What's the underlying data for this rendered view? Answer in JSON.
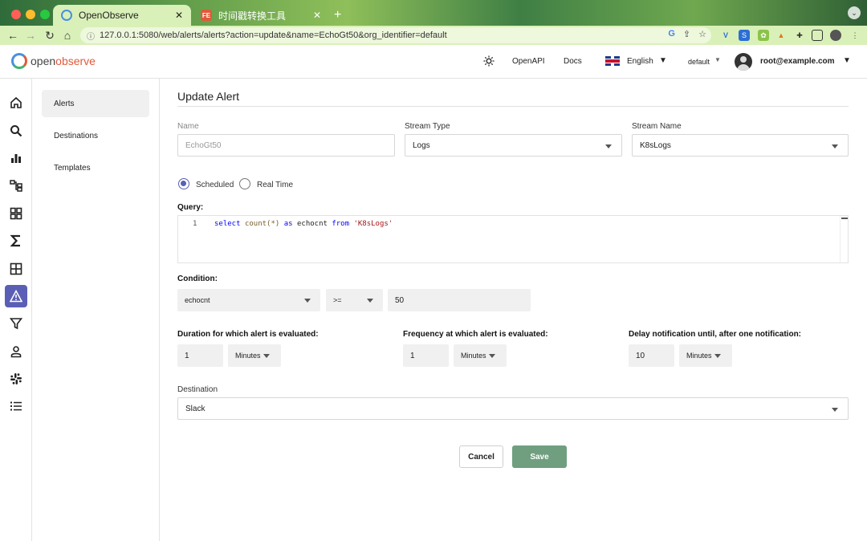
{
  "browser": {
    "tabs": [
      {
        "title": "OpenObserve",
        "active": true
      },
      {
        "title": "时间戳转换工具",
        "active": false
      }
    ],
    "url": "127.0.0.1:5080/web/alerts/alerts?action=update&name=EchoGt50&org_identifier=default"
  },
  "header": {
    "logo_open": "open",
    "logo_observe": "observe",
    "openapi": "OpenAPI",
    "docs": "Docs",
    "language": "English",
    "org": "default",
    "user": "root@example.com"
  },
  "subnav": {
    "items": [
      "Alerts",
      "Destinations",
      "Templates"
    ]
  },
  "form": {
    "title": "Update Alert",
    "name_label": "Name",
    "name_value": "EchoGt50",
    "stream_type_label": "Stream Type",
    "stream_type_value": "Logs",
    "stream_name_label": "Stream Name",
    "stream_name_value": "K8sLogs",
    "scheduled_label": "Scheduled",
    "realtime_label": "Real Time",
    "query_label": "Query:",
    "query_line_number": "1",
    "condition_label": "Condition:",
    "condition_column": "echocnt",
    "condition_operator": ">=",
    "condition_value": "50",
    "duration_label": "Duration for which alert is evaluated:",
    "duration_value": "1",
    "duration_unit": "Minutes",
    "frequency_label": "Frequency at which alert is evaluated:",
    "frequency_value": "1",
    "frequency_unit": "Minutes",
    "delay_label": "Delay notification until, after one notification:",
    "delay_value": "10",
    "delay_unit": "Minutes",
    "destination_label": "Destination",
    "destination_value": "Slack",
    "cancel": "Cancel",
    "save": "Save"
  },
  "query": {
    "select": "select",
    "count": "count(*)",
    "as": "as",
    "alias": "echocnt",
    "from": "from",
    "stream": "'K8sLogs'"
  },
  "colors": {
    "accent": "#5a5fb5",
    "save": "#6f9f7f",
    "brand_red": "#e05a3a"
  }
}
